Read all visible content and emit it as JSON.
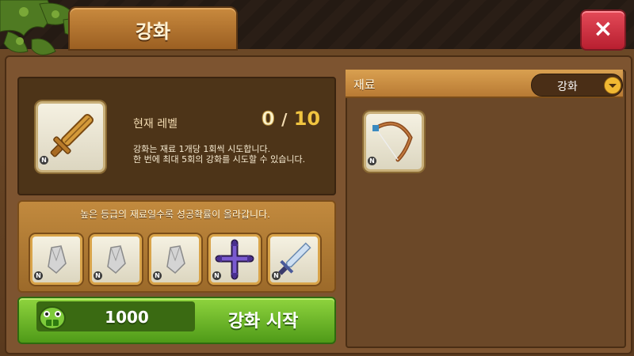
{
  "header": {
    "title": "강화",
    "close_label": "×"
  },
  "upgrade_panel": {
    "item_grade": "N",
    "level_label": "현재 레벨",
    "level_current": "0",
    "level_separator": "/",
    "level_max": "10",
    "description": "강화는 재료 1개당 1회씩 시도합니다.\n한 번에 최대 5회의 강화를 시도할 수 있습니다."
  },
  "materials": {
    "hint": "높은 등급의 재료일수록 성공확률이 올라갑니다.",
    "slots": [
      {
        "icon": "gem-shard-icon",
        "grade": "N"
      },
      {
        "icon": "gem-shard-icon",
        "grade": "N"
      },
      {
        "icon": "gem-shard-icon",
        "grade": "N"
      },
      {
        "icon": "purple-cross-icon",
        "grade": "N"
      },
      {
        "icon": "crystal-sword-icon",
        "grade": "N"
      }
    ]
  },
  "start_button": {
    "cost": "1000",
    "label": "강화 시작"
  },
  "inventory": {
    "title": "재료",
    "filter_selected": "강화",
    "items": [
      {
        "icon": "bow-icon",
        "grade": "N"
      }
    ]
  },
  "colors": {
    "accent_green": "#6cbf2a",
    "close_red": "#d83040",
    "panel_brown": "#4d3418"
  }
}
